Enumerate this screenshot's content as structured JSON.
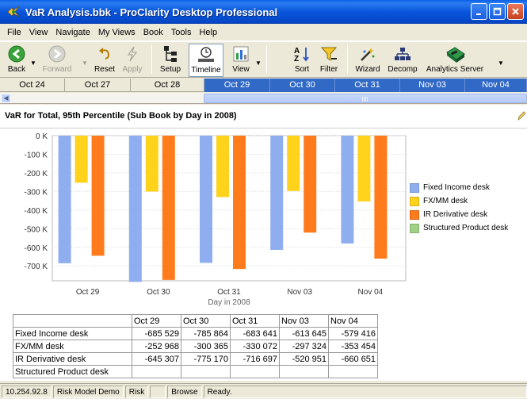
{
  "window": {
    "title": "VaR Analysis.bbk - ProClarity Desktop Professional"
  },
  "menu": [
    "File",
    "View",
    "Navigate",
    "My Views",
    "Book",
    "Tools",
    "Help"
  ],
  "toolbar": {
    "back": "Back",
    "forward": "Forward",
    "reset": "Reset",
    "apply": "Apply",
    "setup": "Setup",
    "timeline": "Timeline",
    "view": "View",
    "sort": "Sort",
    "filter": "Filter",
    "wizard": "Wizard",
    "decomp": "Decomp",
    "analytics_server": "Analytics Server"
  },
  "timeline": {
    "dates": [
      "Oct 24",
      "Oct 27",
      "Oct 28",
      "Oct 29",
      "Oct 30",
      "Oct 31",
      "Nov 03",
      "Nov 04"
    ],
    "selected": [
      "Oct 29",
      "Oct 30",
      "Oct 31",
      "Nov 03",
      "Nov 04"
    ]
  },
  "view": {
    "title": "VaR for Total, 95th Percentile (Sub Book by Day in 2008)"
  },
  "colors": {
    "fixed_income": "#8eaef0",
    "fxmm": "#ffd21c",
    "ir_derivative": "#ff7b1c",
    "structured_product": "#9fd186"
  },
  "chart_data": {
    "type": "bar",
    "categories": [
      "Oct 29",
      "Oct 30",
      "Oct 31",
      "Nov 03",
      "Nov 04"
    ],
    "xlabel": "Day in 2008",
    "ylabel": "",
    "ylim": [
      -780000,
      0
    ],
    "yticks": [
      "0 K",
      "-100 K",
      "-200 K",
      "-300 K",
      "-400 K",
      "-500 K",
      "-600 K",
      "-700 K"
    ],
    "ytick_values": [
      0,
      -100000,
      -200000,
      -300000,
      -400000,
      -500000,
      -600000,
      -700000
    ],
    "grid": true,
    "legend_position": "right",
    "series": [
      {
        "name": "Fixed Income desk",
        "values": [
          -685529,
          -785864,
          -683641,
          -613645,
          -579416
        ]
      },
      {
        "name": "FX/MM desk",
        "values": [
          -252968,
          -300365,
          -330072,
          -297324,
          -353454
        ]
      },
      {
        "name": "IR Derivative desk",
        "values": [
          -645307,
          -775170,
          -716697,
          -520951,
          -660651
        ]
      },
      {
        "name": "Structured Product desk",
        "values": [
          null,
          null,
          null,
          null,
          null
        ]
      }
    ]
  },
  "table": {
    "headers": [
      "",
      "Oct 29",
      "Oct 30",
      "Oct 31",
      "Nov 03",
      "Nov 04"
    ],
    "rows": [
      [
        "Fixed Income desk",
        "-685 529",
        "-785 864",
        "-683 641",
        "-613 645",
        "-579 416"
      ],
      [
        "FX/MM desk",
        "-252 968",
        "-300 365",
        "-330 072",
        "-297 324",
        "-353 454"
      ],
      [
        "IR Derivative desk",
        "-645 307",
        "-775 170",
        "-716 697",
        "-520 951",
        "-660 651"
      ],
      [
        "Structured Product desk",
        "",
        "",
        "",
        "",
        ""
      ]
    ]
  },
  "status": [
    "10.254.92.8",
    "Risk Model Demo",
    "Risk",
    "",
    "Browse",
    "Ready."
  ]
}
